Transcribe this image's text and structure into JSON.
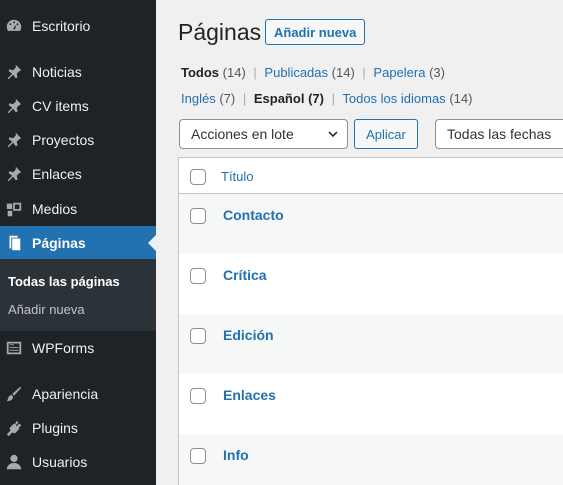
{
  "sidebar": {
    "items": [
      {
        "label": "Escritorio",
        "icon": "dashboard-icon"
      },
      {
        "label": "Noticias",
        "icon": "pin-icon"
      },
      {
        "label": "CV items",
        "icon": "pin-icon"
      },
      {
        "label": "Proyectos",
        "icon": "pin-icon"
      },
      {
        "label": "Enlaces",
        "icon": "pin-icon"
      },
      {
        "label": "Medios",
        "icon": "media-icon"
      },
      {
        "label": "Páginas",
        "icon": "pages-icon",
        "active": true
      },
      {
        "label": "WPForms",
        "icon": "forms-icon"
      },
      {
        "label": "Apariencia",
        "icon": "paintbrush-icon"
      },
      {
        "label": "Plugins",
        "icon": "plugin-icon"
      },
      {
        "label": "Usuarios",
        "icon": "users-icon"
      }
    ],
    "submenu": [
      {
        "label": "Todas las páginas",
        "current": true
      },
      {
        "label": "Añadir nueva"
      }
    ]
  },
  "header": {
    "title": "Páginas",
    "add_new": "Añadir nueva"
  },
  "status_filters": {
    "all_label": "Todos",
    "all_count": "(14)",
    "published_label": "Publicadas",
    "published_count": "(14)",
    "trash_label": "Papelera",
    "trash_count": "(3)"
  },
  "language_filters": {
    "english_label": "Inglés",
    "english_count": "(7)",
    "spanish_label": "Español",
    "spanish_count": "(7)",
    "all_label": "Todos los idiomas",
    "all_count": "(14)"
  },
  "bulk_actions": {
    "selected": "Acciones en lote",
    "apply": "Aplicar",
    "date_filter": "Todas las fechas"
  },
  "table": {
    "column_title": "Título",
    "rows": [
      "Contacto",
      "Crítica",
      "Edición",
      "Enlaces",
      "Info"
    ]
  },
  "colors": {
    "sidebar_bg": "#1d2327",
    "accent": "#2271b1"
  }
}
